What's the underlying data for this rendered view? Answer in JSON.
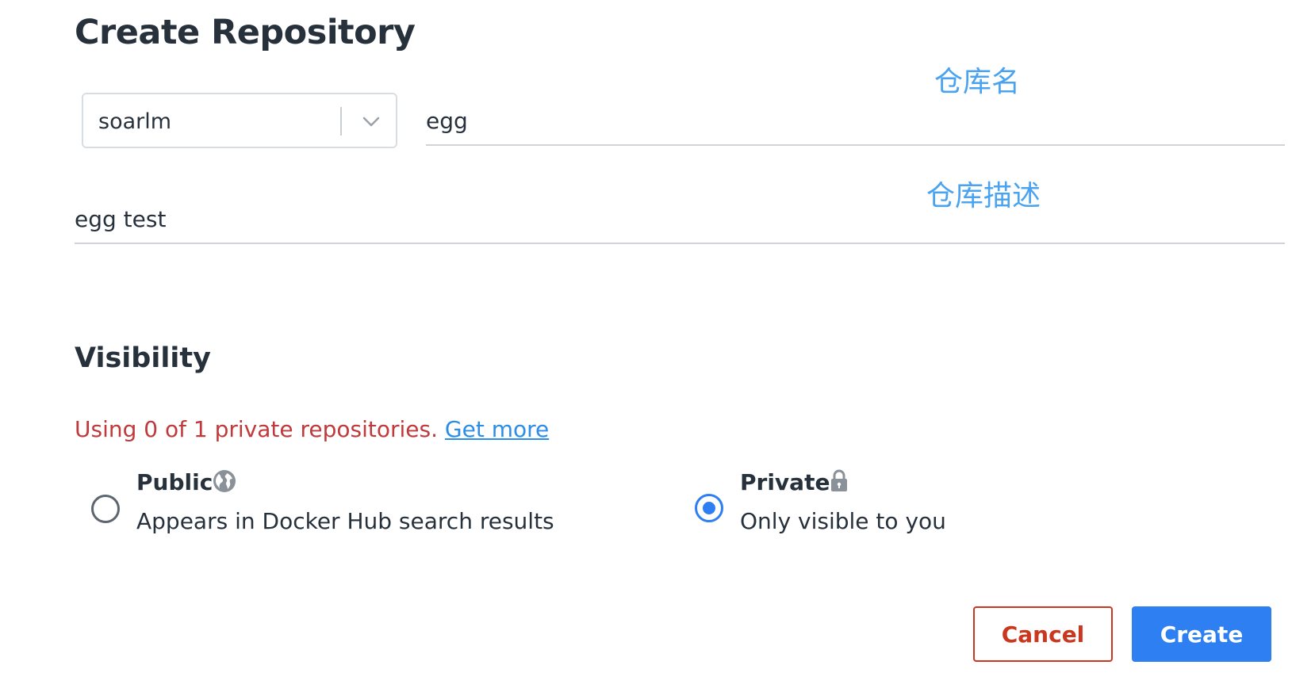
{
  "page": {
    "title": "Create Repository"
  },
  "annotations": {
    "repo_name": "仓库名",
    "repo_description": "仓库描述"
  },
  "form": {
    "namespace": {
      "selected": "soarlm"
    },
    "name": {
      "value": "egg"
    },
    "description": {
      "value": "egg test"
    }
  },
  "visibility": {
    "section_title": "Visibility",
    "usage_text": "Using 0 of 1 private repositories.",
    "get_more_link": "Get more",
    "options": [
      {
        "id": "public",
        "title": "Public",
        "description": "Appears in Docker Hub search results",
        "icon": "globe-icon",
        "selected": false
      },
      {
        "id": "private",
        "title": "Private",
        "description": "Only visible to you",
        "icon": "lock-icon",
        "selected": true
      }
    ]
  },
  "actions": {
    "cancel_label": "Cancel",
    "create_label": "Create"
  },
  "colors": {
    "accent": "#2d7ff2",
    "danger": "#c9371f",
    "warning_text": "#c0393b",
    "link": "#2b8de8",
    "annotation": "#4aa3f0"
  }
}
